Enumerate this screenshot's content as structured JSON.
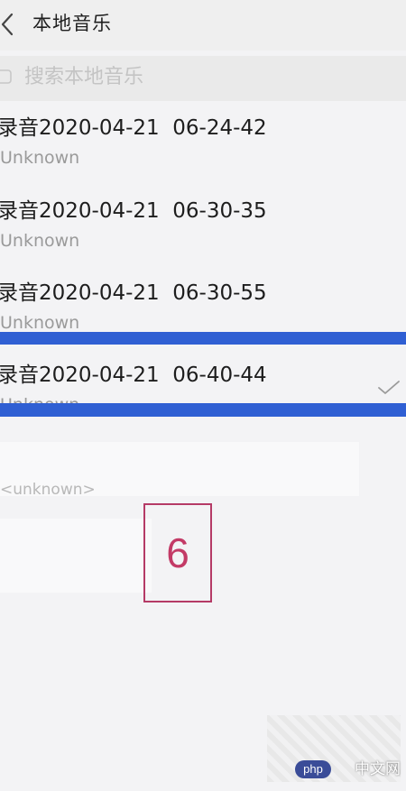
{
  "header": {
    "title": "本地音乐"
  },
  "search": {
    "placeholder": "搜索本地音乐"
  },
  "songs": [
    {
      "title": "录音2020-04-21  06-24-42",
      "artist": "Unknown",
      "selected": false
    },
    {
      "title": "录音2020-04-21  06-30-35",
      "artist": "Unknown",
      "selected": false
    },
    {
      "title": "录音2020-04-21  06-30-55",
      "artist": "Unknown",
      "selected": false
    },
    {
      "title": "录音2020-04-21  06-40-44",
      "artist": "Unknown",
      "selected": true
    }
  ],
  "ghost_row": {
    "text": "<unknown>"
  },
  "annotation": {
    "step": "6"
  },
  "watermark": {
    "brand": "php",
    "site": "中文网"
  },
  "colors": {
    "highlight_band": "#2f5fd3",
    "step_border": "#b53a66",
    "watermark_badge": "#3a4c98"
  },
  "icons": {
    "back": "chevron-left-icon",
    "search": "search-icon",
    "selected": "checkmark-icon"
  }
}
